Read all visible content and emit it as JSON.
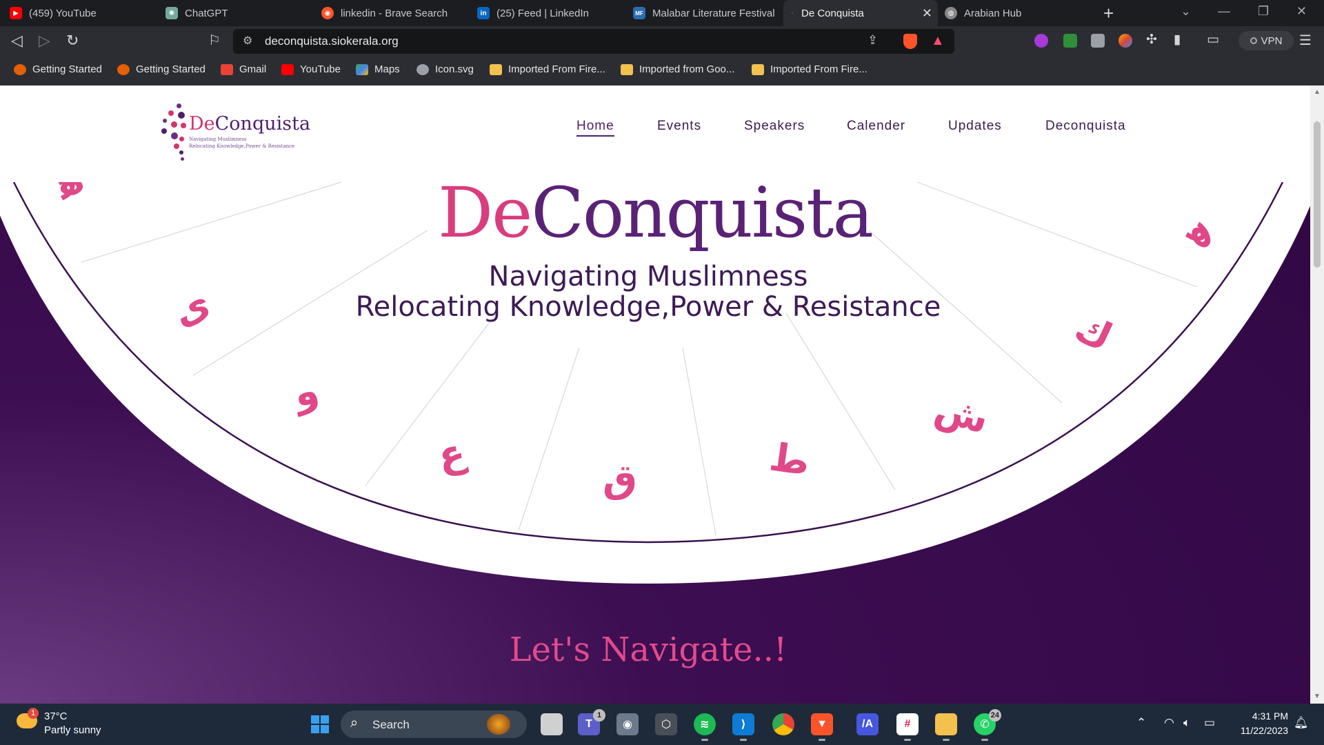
{
  "browser": {
    "tabs": [
      {
        "title": "(459) YouTube",
        "icon": "youtube-icon",
        "color": "#ff0000"
      },
      {
        "title": "ChatGPT",
        "icon": "chatgpt-icon",
        "color": "#74aa9c"
      },
      {
        "title": "linkedin - Brave Search",
        "icon": "brave-search-icon",
        "color": "#fb542b"
      },
      {
        "title": "(25) Feed | LinkedIn",
        "icon": "linkedin-icon",
        "color": "#0a66c2"
      },
      {
        "title": "Malabar Literature Festival",
        "icon": "mlf-icon",
        "color": "#2a6db0"
      },
      {
        "title": "De Conquista",
        "icon": "deconquista-icon",
        "color": "#7a2a6e"
      },
      {
        "title": "Arabian Hub",
        "icon": "globe-icon",
        "color": "#888888"
      }
    ],
    "url": "deconquista.siokerala.org",
    "vpn_label": "VPN",
    "bookmarks": [
      {
        "label": "Getting Started",
        "icon": "firefox-icon",
        "color": "#e66000"
      },
      {
        "label": "Getting Started",
        "icon": "firefox-icon",
        "color": "#e66000"
      },
      {
        "label": "Gmail",
        "icon": "gmail-icon",
        "color": "#ea4335"
      },
      {
        "label": "YouTube",
        "icon": "youtube-icon",
        "color": "#ff0000"
      },
      {
        "label": "Maps",
        "icon": "maps-icon",
        "color": "#34a853"
      },
      {
        "label": "Icon.svg",
        "icon": "globe-icon",
        "color": "#9aa0a6"
      },
      {
        "label": "Imported From Fire...",
        "icon": "folder-icon",
        "color": "#f2c14e"
      },
      {
        "label": "Imported from Goo...",
        "icon": "folder-icon",
        "color": "#f2c14e"
      },
      {
        "label": "Imported From Fire...",
        "icon": "folder-icon",
        "color": "#f2c14e"
      }
    ]
  },
  "site": {
    "logo": {
      "de": "De",
      "rest": "Conquista",
      "sub1": "Navigating Muslimness",
      "sub2": "Relocating Knowledge,Power & Resistance"
    },
    "nav": [
      "Home",
      "Events",
      "Speakers",
      "Calender",
      "Updates",
      "Deconquista"
    ],
    "hero": {
      "title_de": "De",
      "title_rest": "Conquista",
      "tagline1": "Navigating Muslimness",
      "tagline2": "Relocating Knowledge,Power & Resistance"
    },
    "arabic_letters": [
      "ﻫ",
      "ى",
      "و",
      "ع",
      "ق",
      "ط",
      "ش",
      "ك",
      "ﻫ"
    ],
    "navigate_heading": "Let's Navigate..!",
    "colors": {
      "purple": "#5a2277",
      "pink": "#d93d7d",
      "dark": "#2f0742"
    }
  },
  "taskbar": {
    "weather_temp": "37°C",
    "weather_desc": "Partly sunny",
    "weather_badge": "1",
    "search_label": "Search",
    "teams_badge": "1",
    "whatsapp_badge": "24",
    "time": "4:31 PM",
    "date": "11/22/2023"
  }
}
